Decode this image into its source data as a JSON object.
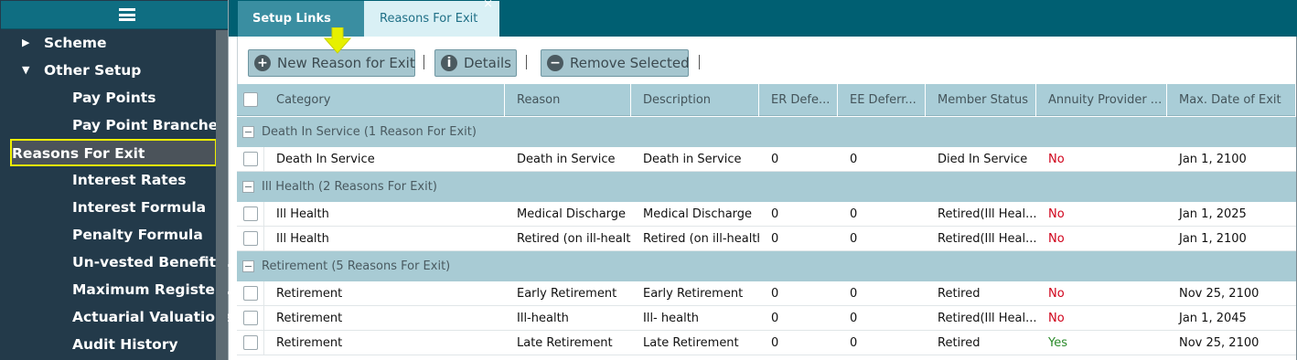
{
  "sidebar": {
    "items": [
      {
        "label": "Scheme",
        "arrow": "▶",
        "kind": "top"
      },
      {
        "label": "Other Setup",
        "arrow": "▼",
        "kind": "top"
      },
      {
        "label": "Pay Points",
        "kind": "sub"
      },
      {
        "label": "Pay Point Branches",
        "kind": "sub"
      },
      {
        "label": "Reasons For Exit",
        "kind": "active"
      },
      {
        "label": "Interest Rates",
        "kind": "sub"
      },
      {
        "label": "Interest Formula",
        "kind": "sub"
      },
      {
        "label": "Penalty Formula",
        "kind": "sub"
      },
      {
        "label": "Un-vested Benefit...",
        "kind": "sub"
      },
      {
        "label": "Maximum Registe...",
        "kind": "sub"
      },
      {
        "label": "Actuarial Valuations",
        "kind": "sub"
      },
      {
        "label": "Audit History",
        "kind": "sub"
      }
    ]
  },
  "tabs": [
    {
      "label": "Setup Links"
    },
    {
      "label": "Reasons For Exit",
      "close": "×"
    }
  ],
  "toolbar": {
    "new_label": "New Reason for Exit",
    "new_icon": "+",
    "details_label": "Details",
    "details_icon": "i",
    "remove_label": "Remove Selected",
    "remove_icon": "−"
  },
  "columns": [
    "Category",
    "Reason",
    "Description",
    "ER Defe...",
    "EE Deferr...",
    "Member Status",
    "Annuity Provider ...",
    "Max. Date of Exit"
  ],
  "groups": [
    {
      "label": "Death In Service (1 Reason For Exit)",
      "rows": [
        [
          "Death In Service",
          "Death in Service",
          "Death in Service",
          "0",
          "0",
          "Died In Service",
          "No",
          "Jan 1, 2100"
        ]
      ]
    },
    {
      "label": "Ill Health (2 Reasons For Exit)",
      "rows": [
        [
          "Ill Health",
          "Medical Discharge",
          "Medical Discharge",
          "0",
          "0",
          "Retired(Ill Heal...",
          "No",
          "Jan 1, 2025"
        ],
        [
          "Ill Health",
          "Retired (on ill-health",
          "Retired (on ill-health",
          "0",
          "0",
          "Retired(Ill Heal...",
          "No",
          "Jan 1, 2100"
        ]
      ]
    },
    {
      "label": "Retirement (5 Reasons For Exit)",
      "rows": [
        [
          "Retirement",
          "Early Retirement",
          "Early Retirement",
          "0",
          "0",
          "Retired",
          "No",
          "Nov 25, 2100"
        ],
        [
          "Retirement",
          "Ill-health",
          "Ill- health",
          "0",
          "0",
          "Retired(Ill Heal...",
          "No",
          "Jan 1, 2045"
        ],
        [
          "Retirement",
          "Late Retirement",
          "Late Retirement",
          "0",
          "0",
          "Retired",
          "Yes",
          "Nov 25, 2100"
        ]
      ]
    }
  ],
  "colors": {
    "accent": "#005f72",
    "highlight": "#f0f000",
    "no": "#d0021b",
    "yes": "#2a8a2a"
  }
}
